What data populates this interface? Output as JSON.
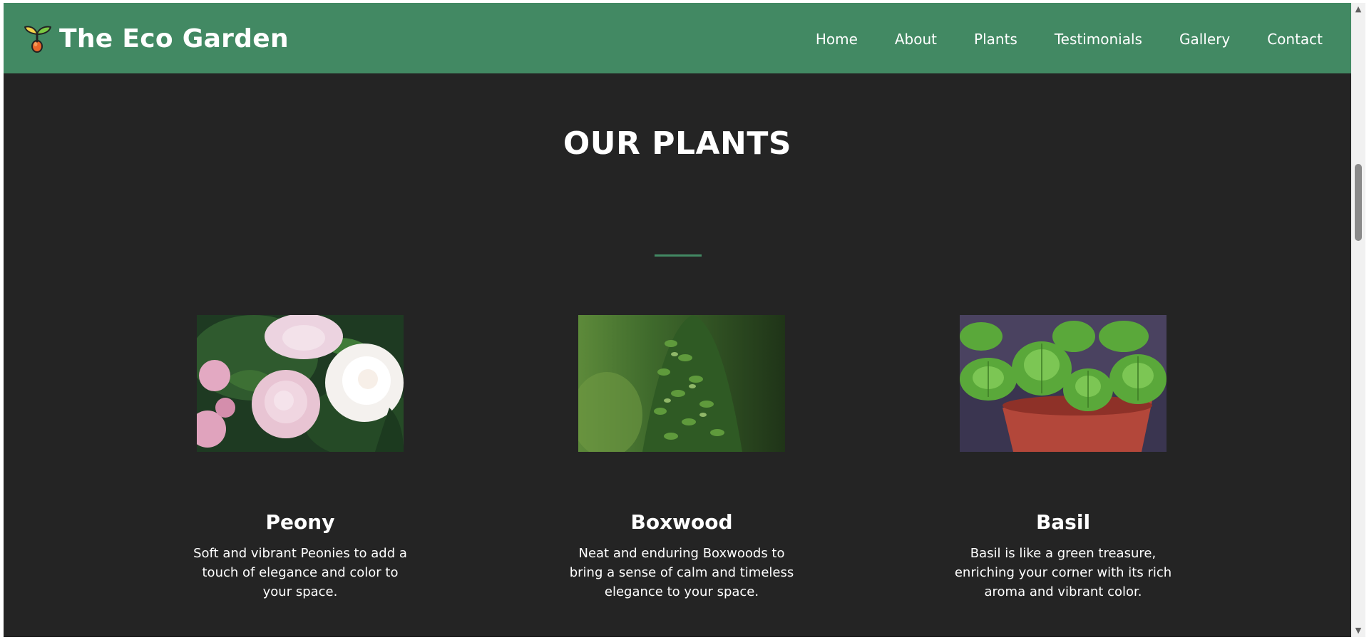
{
  "header": {
    "brand_title": "The Eco Garden",
    "brand_icon": "sprout-icon",
    "nav": [
      {
        "label": "Home"
      },
      {
        "label": "About"
      },
      {
        "label": "Plants"
      },
      {
        "label": "Testimonials"
      },
      {
        "label": "Gallery"
      },
      {
        "label": "Contact"
      }
    ]
  },
  "section": {
    "title": "OUR PLANTS"
  },
  "plants": [
    {
      "name": "Peony",
      "description": "Soft and vibrant Peonies to add a touch of elegance and color to your space."
    },
    {
      "name": "Boxwood",
      "description": "Neat and enduring Boxwoods to bring a sense of calm and timeless elegance to your space."
    },
    {
      "name": "Basil",
      "description": "Basil is like a green treasure, enriching your corner with its rich aroma and vibrant color."
    }
  ],
  "colors": {
    "header_bg": "#428963",
    "page_bg": "#242424",
    "accent": "#428963",
    "text": "#ffffff"
  }
}
